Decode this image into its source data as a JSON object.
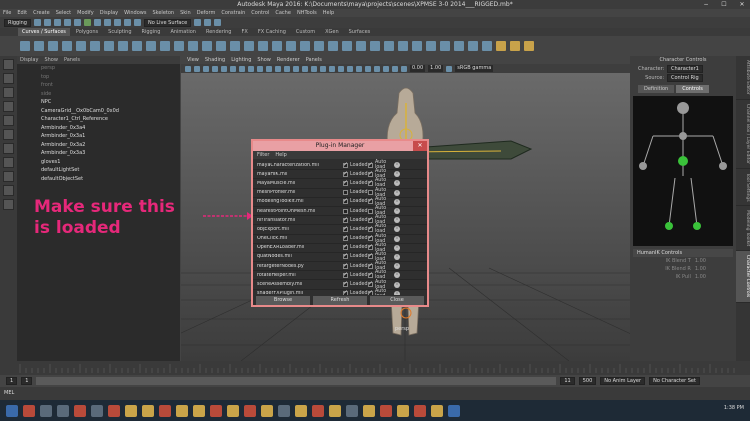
{
  "window": {
    "title": "Autodesk Maya 2016: K:\\Documents\\maya\\projects\\scenes\\XPMSE 3-0 2014___RIGGED.mb*",
    "controls": [
      "−",
      "☐",
      "✕"
    ]
  },
  "menubar": [
    "File",
    "Edit",
    "Create",
    "Select",
    "Modify",
    "Display",
    "Windows",
    "Skeleton",
    "Skin",
    "Deform",
    "Constrain",
    "Control",
    "Cache",
    "NHTools",
    "Help"
  ],
  "shelf": {
    "mode": "Rigging",
    "surface_dropdown": "No Live Surface",
    "tabs": [
      "Curves / Surfaces",
      "Polygons",
      "Sculpting",
      "Rigging",
      "Animation",
      "Rendering",
      "FX",
      "FX Caching",
      "Custom",
      "XGen",
      "Surfaces"
    ],
    "active_tab": "Curves / Surfaces"
  },
  "outliner": {
    "menu": [
      "Display",
      "Show",
      "Panels"
    ],
    "items": [
      {
        "label": "persp",
        "dim": true
      },
      {
        "label": "top",
        "dim": true
      },
      {
        "label": "front",
        "dim": true
      },
      {
        "label": "side",
        "dim": true
      },
      {
        "label": "NPC",
        "dim": false
      },
      {
        "label": "CameraGrid__Ox0bCam0_0x0d",
        "dim": false
      },
      {
        "label": "Character1_Ctrl_Reference",
        "dim": false
      },
      {
        "label": "Armbinder_0x3a4",
        "dim": false
      },
      {
        "label": "Armbinder_0x3a1",
        "dim": false
      },
      {
        "label": "Armbinder_0x3a2",
        "dim": false
      },
      {
        "label": "Armbinder_0x3a3",
        "dim": false
      },
      {
        "label": "gloves1",
        "dim": false
      },
      {
        "label": "defaultLightSet",
        "dim": false
      },
      {
        "label": "defaultObjectSet",
        "dim": false
      }
    ]
  },
  "annotation": {
    "line1": "Make sure this",
    "line2": "is loaded",
    "color": "#e6287a"
  },
  "viewport": {
    "menu": [
      "View",
      "Shading",
      "Lighting",
      "Show",
      "Renderer",
      "Panels"
    ],
    "field_a": "0.00",
    "field_b": "1.00",
    "color_space": "sRGB gamma",
    "camera_label": "persp"
  },
  "plugin_manager": {
    "title": "Plug-in Manager",
    "close": "✕",
    "menu": [
      "Filter",
      "Help"
    ],
    "loaded_label": "Loaded",
    "autoload_label": "Auto load",
    "info_glyph": "i",
    "plugins": [
      {
        "name": "mayaCharacterization.mll",
        "loaded": true,
        "auto": true
      },
      {
        "name": "mayaHIK.mll",
        "loaded": true,
        "auto": true
      },
      {
        "name": "MayaMuscle.mll",
        "loaded": true,
        "auto": true
      },
      {
        "name": "meshProfiler.mll",
        "loaded": false,
        "auto": false
      },
      {
        "name": "modelingToolkit.mll",
        "loaded": true,
        "auto": true
      },
      {
        "name": "nearestPointOnMesh.mll",
        "loaded": false,
        "auto": false
      },
      {
        "name": "nifTranslator.mll",
        "loaded": true,
        "auto": true
      },
      {
        "name": "objExport.mll",
        "loaded": true,
        "auto": true
      },
      {
        "name": "OneClick.mll",
        "loaded": true,
        "auto": true
      },
      {
        "name": "OpenEXRLoader.mll",
        "loaded": true,
        "auto": true
      },
      {
        "name": "quatNodes.mll",
        "loaded": true,
        "auto": true
      },
      {
        "name": "retargeterNodes.py",
        "loaded": true,
        "auto": true
      },
      {
        "name": "rotateHelper.mll",
        "loaded": true,
        "auto": true
      },
      {
        "name": "sceneAssembly.mll",
        "loaded": true,
        "auto": true
      },
      {
        "name": "shaderFXPlugin.mll",
        "loaded": true,
        "auto": true
      }
    ],
    "buttons": {
      "browse": "Browse",
      "refresh": "Refresh",
      "close": "Close"
    }
  },
  "character_controls": {
    "title": "Character Controls",
    "character_label": "Character:",
    "character_value": "Character1",
    "source_label": "Source:",
    "source_value": "Control Rig",
    "tabs": [
      "Definition",
      "Controls"
    ],
    "active_tab": "Controls",
    "section": "HumanIK Controls",
    "rows": [
      {
        "label": "IK Blend T",
        "value": "1.00"
      },
      {
        "label": "IK Blend R",
        "value": "1.00"
      },
      {
        "label": "IK Pull",
        "value": "1.00"
      }
    ]
  },
  "side_tabs": [
    "Attribute Editor",
    "Channel Box / Layer Editor",
    "Tool Settings",
    "Modeling Toolkit",
    "Character Controls"
  ],
  "side_tabs_active": "Character Controls",
  "range": {
    "start": "1",
    "current": "1",
    "end_a": "11",
    "end_b": "500",
    "anim_layer": "No Anim Layer",
    "char_set": "No Character Set"
  },
  "command_line": {
    "label": "MEL"
  },
  "taskbar": {
    "time": "1:38 PM"
  }
}
